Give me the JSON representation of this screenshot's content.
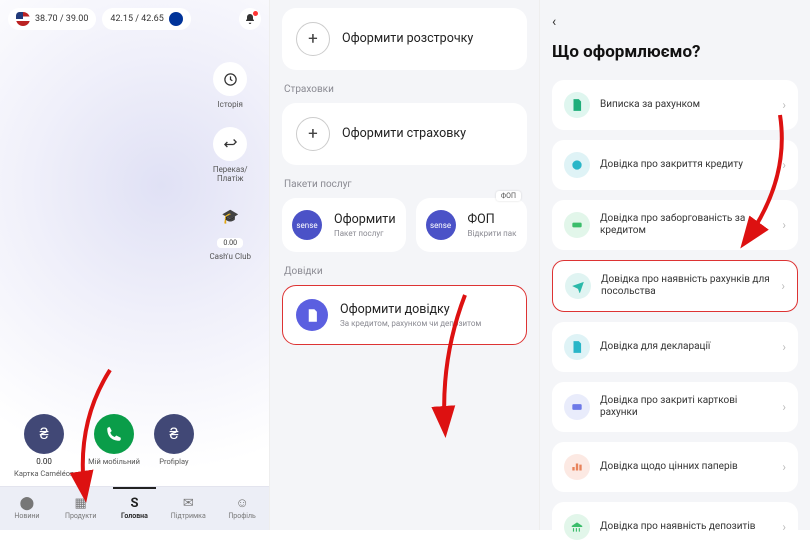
{
  "s1": {
    "rates": {
      "usd": "38.70 / 39.00",
      "eur": "42.15 / 42.65"
    },
    "mid": {
      "history": "Історія",
      "transfer": "Переказ/\nПлатіж",
      "cashu_amount": "0.00",
      "cashu": "Cash'u Club"
    },
    "bottom": [
      {
        "amount": "0.00",
        "label": "Картка Caméléon"
      },
      {
        "amount": "",
        "label": "Мій мобільний"
      },
      {
        "amount": "",
        "label": "Profiplay"
      }
    ],
    "tabs": {
      "news": "Новини",
      "products": "Продукти",
      "home": "Головна",
      "support": "Підтримка",
      "profile": "Профіль"
    }
  },
  "s2": {
    "installment": {
      "title": "Оформити розстрочку"
    },
    "insurance_label": "Страховки",
    "insurance": {
      "title": "Оформити страховку"
    },
    "packages_label": "Пакети послуг",
    "pkg1": {
      "title": "Оформити",
      "sub": "Пакет послуг"
    },
    "pkg2": {
      "title": "ФОП",
      "sub": "Відкрити пак",
      "tag": "ФОП"
    },
    "certs_label": "Довідки",
    "cert": {
      "title": "Оформити довідку",
      "sub": "За кредитом, рахунком чи депозитом"
    },
    "sense": "sense"
  },
  "s3": {
    "title": "Що оформлюємо?",
    "options": [
      "Виписка за рахунком",
      "Довідка про закриття кредиту",
      "Довідка про заборгованість за кредитом",
      "Довідка про наявність рахунків для посольства",
      "Довідка для декларації",
      "Довідка про закриті карткові рахунки",
      "Довідка щодо цінних паперів",
      "Довідка про наявність депозитів"
    ]
  }
}
